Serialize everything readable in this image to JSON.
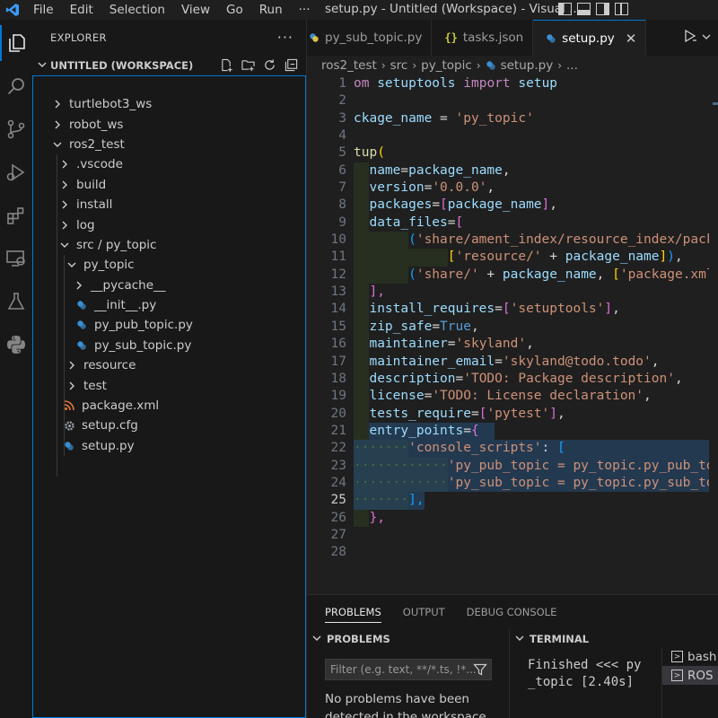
{
  "titlebar": {
    "menu": [
      "File",
      "Edit",
      "Selection",
      "View",
      "Go",
      "Run",
      "···"
    ],
    "title": "setup.py - Untitled (Workspace) - Visual ..."
  },
  "explorer": {
    "header": "EXPLORER",
    "workspace": "UNTITLED (WORKSPACE)",
    "items": [
      {
        "label": "turtlebot3_ws",
        "type": "folder",
        "open": false,
        "depth": 0
      },
      {
        "label": "robot_ws",
        "type": "folder",
        "open": false,
        "depth": 0
      },
      {
        "label": "ros2_test",
        "type": "folder",
        "open": true,
        "depth": 0
      },
      {
        "label": ".vscode",
        "type": "folder",
        "open": false,
        "depth": 1
      },
      {
        "label": "build",
        "type": "folder",
        "open": false,
        "depth": 1
      },
      {
        "label": "install",
        "type": "folder",
        "open": false,
        "depth": 1
      },
      {
        "label": "log",
        "type": "folder",
        "open": false,
        "depth": 1
      },
      {
        "label": "src / py_topic",
        "type": "folder",
        "open": true,
        "depth": 1
      },
      {
        "label": "py_topic",
        "type": "folder",
        "open": true,
        "depth": 2
      },
      {
        "label": "__pycache__",
        "type": "folder",
        "open": false,
        "depth": 3
      },
      {
        "label": "__init__.py",
        "type": "python",
        "depth": 3
      },
      {
        "label": "py_pub_topic.py",
        "type": "python",
        "depth": 3
      },
      {
        "label": "py_sub_topic.py",
        "type": "python",
        "depth": 3
      },
      {
        "label": "resource",
        "type": "folder",
        "open": false,
        "depth": 2
      },
      {
        "label": "test",
        "type": "folder",
        "open": false,
        "depth": 2
      },
      {
        "label": "package.xml",
        "type": "xml",
        "depth": 2
      },
      {
        "label": "setup.cfg",
        "type": "gear",
        "depth": 2
      },
      {
        "label": "setup.py",
        "type": "python",
        "depth": 2
      }
    ]
  },
  "tabs": [
    {
      "label": "py_sub_topic.py",
      "icon": "python-icon",
      "active": false
    },
    {
      "label": "tasks.json",
      "icon": "json-icon",
      "active": false
    },
    {
      "label": "setup.py",
      "icon": "python-icon",
      "active": true
    }
  ],
  "breadcrumb": [
    "ros2_test",
    "src",
    "py_topic",
    "setup.py",
    "..."
  ],
  "editor": {
    "current_line": 25,
    "line_numbers": [
      "1",
      "2",
      "3",
      "4",
      "5",
      "6",
      "7",
      "8",
      "9",
      "10",
      "11",
      "12",
      "13",
      "14",
      "15",
      "16",
      "17",
      "18",
      "19",
      "20",
      "21",
      "22",
      "23",
      "24",
      "25",
      "26",
      "27",
      "28"
    ]
  },
  "panel": {
    "tabs": [
      "PROBLEMS",
      "OUTPUT",
      "DEBUG CONSOLE"
    ],
    "problems_header": "PROBLEMS",
    "terminal_header": "TERMINAL",
    "filter_placeholder": "Filter (e.g. text, **/*.ts, !*...",
    "problems_message": "No problems have been detected in the workspace",
    "terminal_line1": "Finished <<< py",
    "terminal_line2": "_topic [2.40s]",
    "terminals": [
      "bash",
      "ROS"
    ]
  },
  "colors": {
    "accent": "#0078d4",
    "string": "#ce9178",
    "keyword": "#c586c0",
    "variable": "#9cdcfe"
  }
}
